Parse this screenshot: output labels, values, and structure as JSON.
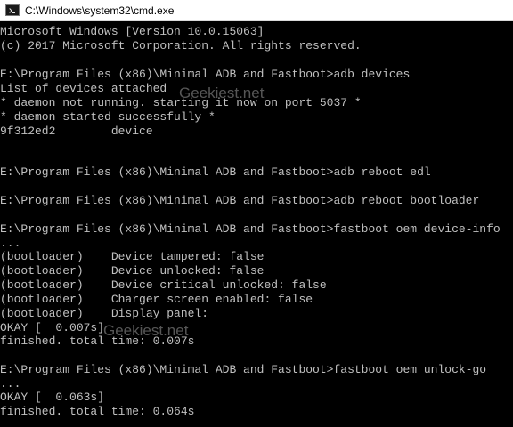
{
  "window": {
    "title": "C:\\Windows\\system32\\cmd.exe",
    "icon": "cmd-icon"
  },
  "console": {
    "lines": [
      "Microsoft Windows [Version 10.0.15063]",
      "(c) 2017 Microsoft Corporation. All rights reserved.",
      "E:\\Program Files (x86)\\Minimal ADB and Fastboot>adb devices",
      "List of devices attached",
      "* daemon not running. starting it now on port 5037 *",
      "* daemon started successfully *",
      "9f312ed2        device",
      "E:\\Program Files (x86)\\Minimal ADB and Fastboot>adb reboot edl",
      "E:\\Program Files (x86)\\Minimal ADB and Fastboot>adb reboot bootloader",
      "E:\\Program Files (x86)\\Minimal ADB and Fastboot>fastboot oem device-info",
      "...",
      "(bootloader)    Device tampered: false",
      "(bootloader)    Device unlocked: false",
      "(bootloader)    Device critical unlocked: false",
      "(bootloader)    Charger screen enabled: false",
      "(bootloader)    Display panel:",
      "OKAY [  0.007s]",
      "finished. total time: 0.007s",
      "E:\\Program Files (x86)\\Minimal ADB and Fastboot>fastboot oem unlock-go",
      "...",
      "OKAY [  0.063s]",
      "finished. total time: 0.064s"
    ]
  },
  "watermark": {
    "text": "Geekiest.net"
  }
}
